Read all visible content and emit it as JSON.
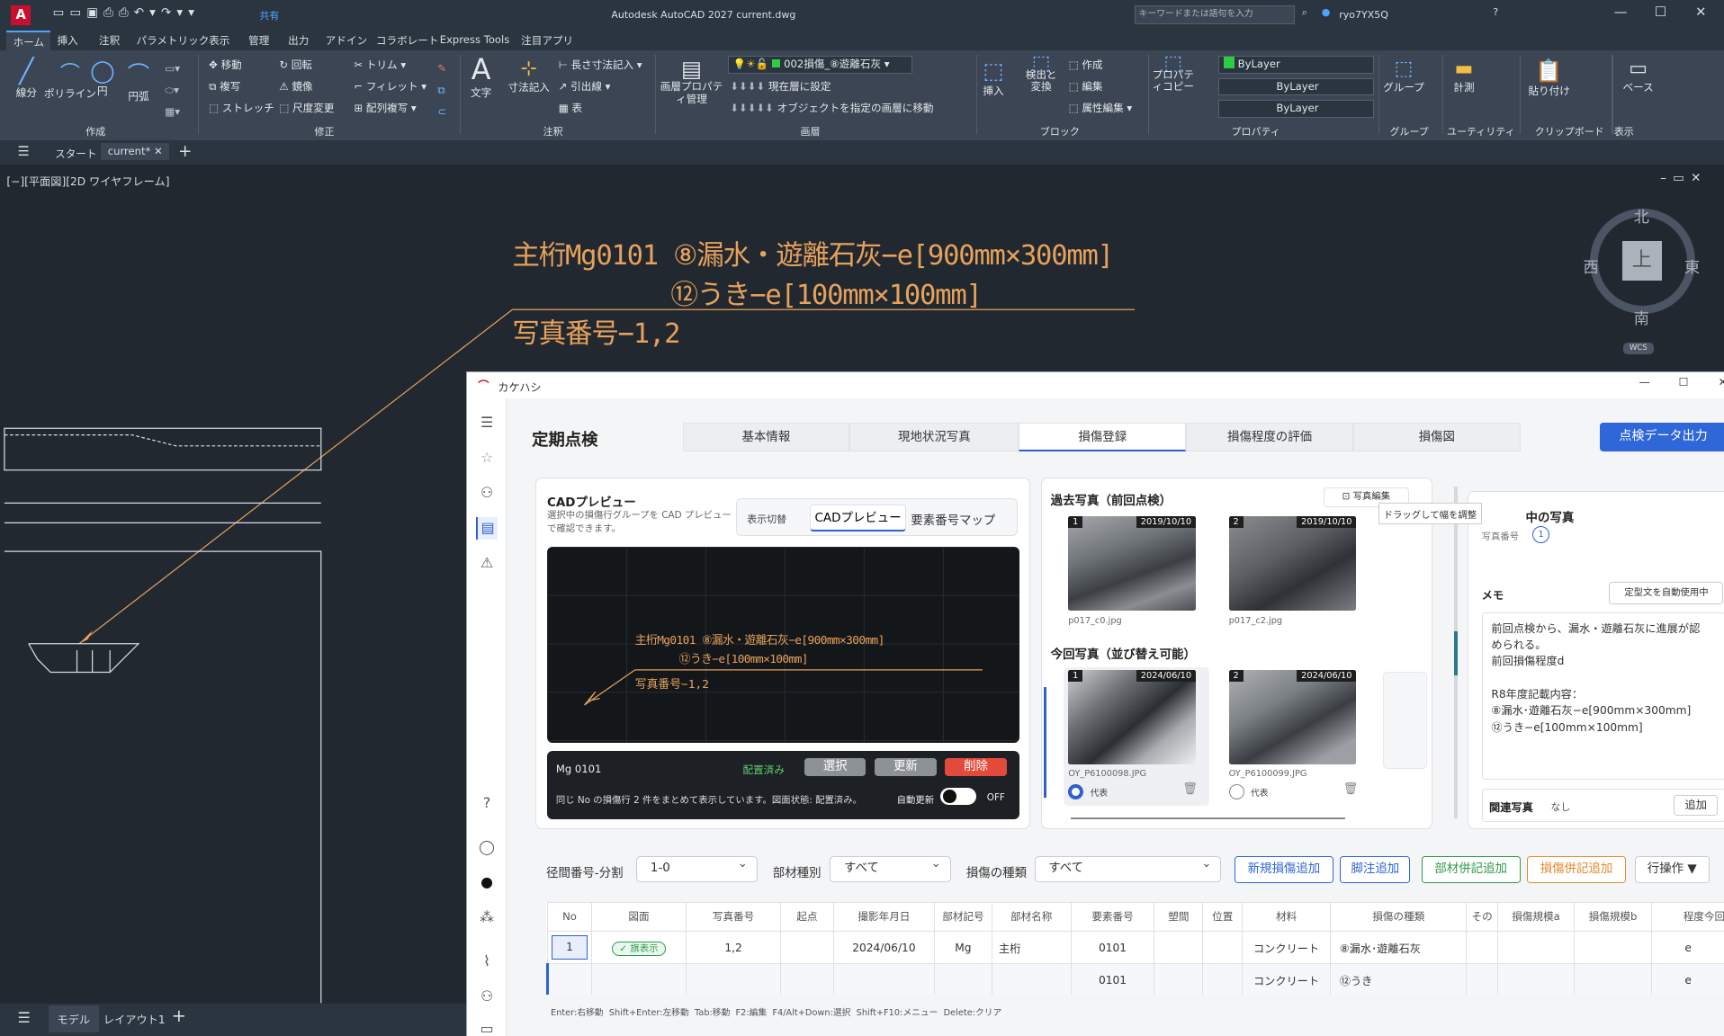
{
  "app": {
    "title": "Autodesk AutoCAD 2027  current.dwg",
    "search_placeholder": "キーワードまたは語句を入力",
    "user": "ryo7YX5Q",
    "share": "共有"
  },
  "ribbon_tabs": [
    "ホーム",
    "挿入",
    "注釈",
    "パラメトリック",
    "表示",
    "管理",
    "出力",
    "アドイン",
    "コラボレート",
    "Express Tools",
    "注目アプリ"
  ],
  "ribbon": {
    "draw": {
      "label": "作成",
      "items": [
        "線分",
        "ポリライン",
        "円",
        "円弧"
      ]
    },
    "modify": {
      "label": "修正",
      "items": [
        "移動",
        "回転",
        "トリム",
        "複写",
        "鏡像",
        "フィレット",
        "ストレッチ",
        "尺度変更",
        "配列複写"
      ]
    },
    "annotation": {
      "label": "注釈",
      "items": [
        "文字",
        "寸法記入",
        "長さ寸法記入",
        "引出線",
        "表"
      ]
    },
    "layers": {
      "label": "画層",
      "layer_props": "画層プロパティ管理",
      "current_layer": "002損傷_⑧遊離石灰",
      "set_current": "現在層に設定",
      "match": "オブジェクトを指定の画層に移動"
    },
    "block": {
      "label": "ブロック",
      "insert": "挿入",
      "detect": "検出と変換",
      "create": "作成",
      "edit": "編集",
      "attr": "属性編集"
    },
    "properties": {
      "label": "プロパティ",
      "copy": "プロパティコピー",
      "color": "ByLayer",
      "linetype": "ByLayer",
      "lineweight": "ByLayer"
    },
    "groups": {
      "label": "グループ",
      "group": "グループ"
    },
    "utilities": {
      "label": "ユーティリティ",
      "measure": "計測"
    },
    "clipboard": {
      "label": "クリップボード",
      "paste": "貼り付け"
    },
    "view": {
      "label": "表示",
      "base": "ベース"
    }
  },
  "doc_tabs": [
    "スタート",
    "current*"
  ],
  "viewport_label": "[−][平面図][2D ワイヤフレーム]",
  "drawing_text": {
    "line1": "主桁Mg0101 ⑧漏水・遊離石灰−e[900mm×300mm]",
    "line2": "⑫うき−e[100mm×100mm]",
    "line3": "写真番号−1,2"
  },
  "viewcube": {
    "n": "北",
    "s": "南",
    "e": "東",
    "w": "西",
    "top": "上",
    "wcs": "WCS"
  },
  "status_tabs": [
    "モデル",
    "レイアウト1"
  ],
  "kk": {
    "title": "カケハシ",
    "heading": "定期点検",
    "tabs": [
      "基本情報",
      "現地状況写真",
      "損傷登録",
      "損傷程度の評価",
      "損傷図"
    ],
    "export": "点検データ出力",
    "cad": {
      "title": "CADプレビュー",
      "desc": "選択中の損傷行グループを CAD プレビューで確認できます。",
      "toggle_label": "表示切替",
      "mode_cad": "CADプレビュー",
      "mode_map": "要素番号マップ",
      "line1": "主桁Mg0101  ⑧漏水・遊離石灰−e[900mm×300mm]",
      "line2": "⑫うき−e[100mm×100mm]",
      "line3": "写真番号−1,2",
      "member": "Mg 0101",
      "state": "配置済み",
      "select": "選択",
      "update": "更新",
      "delete": "削除",
      "note": "同じ No の損傷行 2 件をまとめて表示しています。図面状態: 配置済み。",
      "auto": "自動更新",
      "off": "OFF"
    },
    "past": {
      "title": "過去写真（前回点検）",
      "edit": "写真編集",
      "tooltip": "ドラッグして幅を調整",
      "photos": [
        {
          "n": "1",
          "date": "2019/10/10",
          "file": "p017_c0.jpg"
        },
        {
          "n": "2",
          "date": "2019/10/10",
          "file": "p017_c2.jpg"
        }
      ]
    },
    "current": {
      "title": "今回写真（並び替え可能）",
      "rep": "代表",
      "photos": [
        {
          "n": "1",
          "date": "2024/06/10",
          "file": "OY_P6100098.JPG"
        },
        {
          "n": "2",
          "date": "2024/06/10",
          "file": "OY_P6100099.JPG"
        }
      ]
    },
    "right": {
      "selected_title": "中の写真",
      "photo_no_label": "写真番号",
      "photo_no": "1",
      "memo": "メモ",
      "auto_btn": "定型文を自動使用中",
      "memo_lines": [
        "前回点検から、漏水・遊離石灰に進展が認",
        "められる。",
        "前回損傷程度d",
        "",
        "R8年度記載内容：",
        "⑧漏水･遊離石灰−e[900mm×300mm]",
        "⑫うき−e[100mm×100mm]"
      ],
      "related": "関連写真",
      "related_val": "なし",
      "add": "追加"
    },
    "filters": {
      "span_label": "径間番号-分割",
      "span": "1-0",
      "member_label": "部材種別",
      "member": "すべて",
      "damage_label": "損傷の種類",
      "damage": "すべて"
    },
    "actions": {
      "new": "新規損傷追加",
      "foot": "脚注追加",
      "member_note": "部材併記追加",
      "damage_note": "損傷併記追加",
      "row_ops": "行操作 ▼"
    },
    "columns": [
      "No",
      "図面",
      "写真番号",
      "起点",
      "撮影年月日",
      "部材記号",
      "部材名称",
      "要素番号",
      "塑間",
      "位置",
      "材料",
      "損傷の種類",
      "その",
      "損傷規模a",
      "損傷規模b",
      "程度今回"
    ],
    "rows": [
      {
        "no": "1",
        "badge": "✓ 旗表示",
        "photo": "1,2",
        "date": "2024/06/10",
        "sym": "Mg",
        "name": "主桁",
        "elem": "0101",
        "mat": "コンクリート",
        "dmg": "⑧漏水･遊離石灰",
        "deg": "e"
      },
      {
        "no": "",
        "badge": "",
        "photo": "",
        "date": "",
        "sym": "",
        "name": "",
        "elem": "0101",
        "mat": "コンクリート",
        "dmg": "⑫うき",
        "deg": "e"
      }
    ],
    "shortcuts": "Enter:右移動  Shift+Enter:左移動  Tab:移動  F2:編集  F4/Alt+Down:選択  Shift+F10:メニュー  Delete:クリア"
  }
}
